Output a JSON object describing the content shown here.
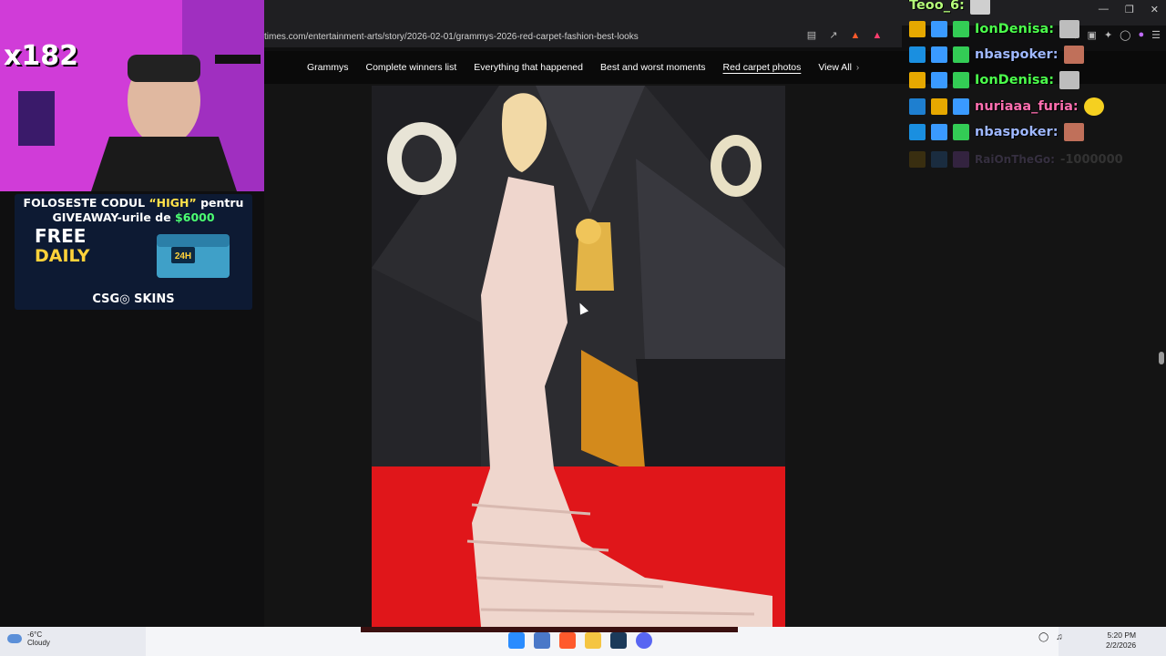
{
  "browser": {
    "url": "times.com/entertainment-arts/story/2026-02-01/grammys-2026-red-carpet-fashion-best-looks"
  },
  "nav": {
    "items": [
      {
        "label": "Grammys"
      },
      {
        "label": "Complete winners list"
      },
      {
        "label": "Everything that happened"
      },
      {
        "label": "Best and worst moments"
      },
      {
        "label": "Red carpet photos"
      },
      {
        "label": "View All"
      }
    ]
  },
  "stream": {
    "multiplier": "x182",
    "promo": {
      "line1_a": "FOLOSESTE CODUL ",
      "line1_code": "“HIGH”",
      "line1_b": " pentru",
      "line2_a": "GIVEAWAY-urile de ",
      "line2_money": "$6000",
      "free": "FREE",
      "daily": "DAILY",
      "chest_label": "24H",
      "brand": "CSG◎ SKINS"
    }
  },
  "chat": {
    "messages": [
      {
        "user": "Teoo_6:",
        "color": "#b6ff7a"
      },
      {
        "user": "IonDenisa:",
        "color": "#4cff4c"
      },
      {
        "user": "nbaspoker:",
        "color": "#9fb8ff"
      },
      {
        "user": "IonDenisa:",
        "color": "#4cff4c"
      },
      {
        "user": "nuriaaa_furia:",
        "color": "#ff6fb0"
      },
      {
        "user": "nbaspoker:",
        "color": "#9fb8ff"
      },
      {
        "user": "RaiOnTheGo:",
        "color": "#c8a8ff",
        "text": "-1000000"
      }
    ]
  },
  "taskbar": {
    "weather_temp": "-6°C",
    "weather_desc": "Cloudy",
    "time": "5:20 PM",
    "date": "2/2/2026"
  },
  "colors": {
    "nav_bg": "#0a0a0a",
    "page_bg": "#141414",
    "red_carpet": "#e0161a",
    "cam_bg": "#d040dc"
  }
}
